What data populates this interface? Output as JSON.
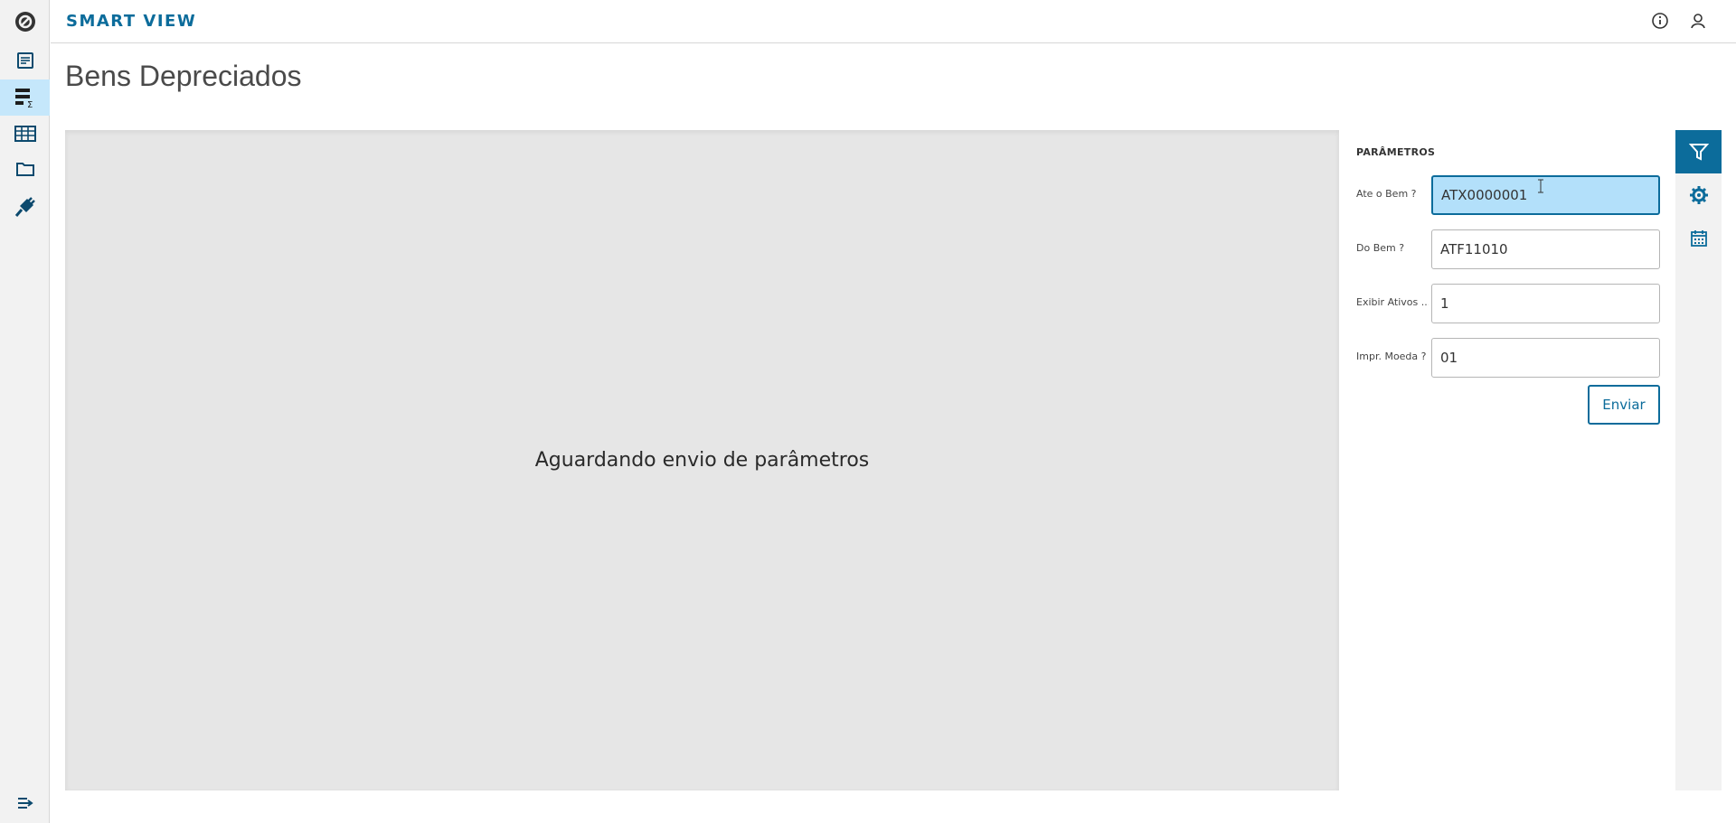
{
  "app": {
    "brand": "SMART VIEW"
  },
  "header": {
    "icons": [
      "info-icon",
      "user-icon"
    ]
  },
  "sidebar": {
    "items": [
      {
        "name": "logo-icon"
      },
      {
        "name": "report-icon"
      },
      {
        "name": "report-sum-icon",
        "active": true
      },
      {
        "name": "table-icon"
      },
      {
        "name": "folder-icon"
      },
      {
        "name": "plug-icon"
      }
    ],
    "bottom": {
      "name": "expand-menu-icon"
    }
  },
  "page": {
    "title": "Bens Depreciados",
    "message": "Aguardando envio de parâmetros"
  },
  "params": {
    "title": "PARÂMETROS",
    "fields": [
      {
        "label": "Ate o Bem ?",
        "value": "ATX0000001"
      },
      {
        "label": "Do Bem ?",
        "value": "ATF11010"
      },
      {
        "label": "Exibir Ativos ...",
        "value": "1"
      },
      {
        "label": "Impr. Moeda ?",
        "value": "01"
      }
    ],
    "submit_label": "Enviar"
  },
  "tools": [
    {
      "name": "filter-icon",
      "active": true
    },
    {
      "name": "gear-icon"
    },
    {
      "name": "calendar-icon"
    }
  ],
  "colors": {
    "accent": "#0c6c9b",
    "active_sidebar": "#c5e7fb",
    "focused_input": "#b3e0fa",
    "report_bg": "#e6e6e6"
  }
}
